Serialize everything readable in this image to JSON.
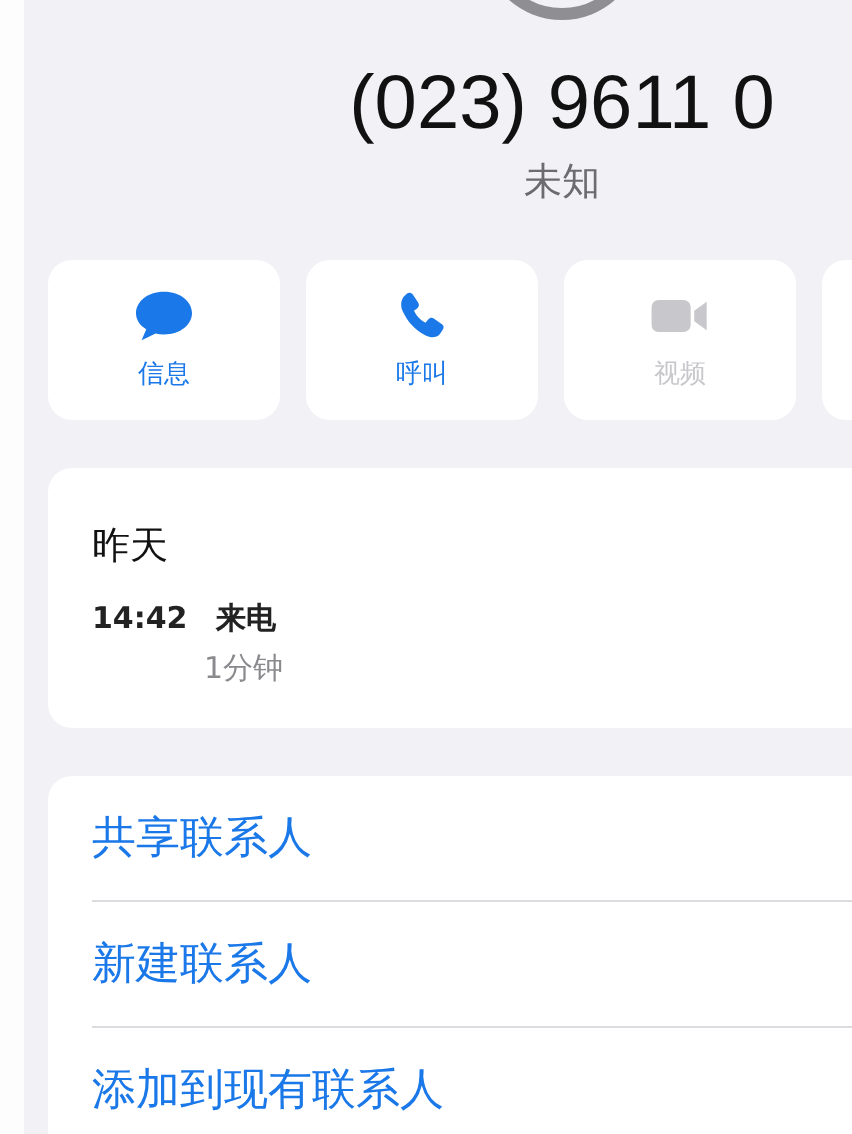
{
  "contact": {
    "number": "(023) 9611 0",
    "label": "未知"
  },
  "actions": [
    {
      "kind": "message",
      "label": "信息",
      "disabled": false
    },
    {
      "kind": "call",
      "label": "呼叫",
      "disabled": false
    },
    {
      "kind": "video",
      "label": "视频",
      "disabled": true
    }
  ],
  "recents": {
    "day": "昨天",
    "calls": [
      {
        "time": "14:42",
        "type": "来电",
        "duration": "1分钟"
      }
    ]
  },
  "options": [
    "共享联系人",
    "新建联系人",
    "添加到现有联系人"
  ]
}
